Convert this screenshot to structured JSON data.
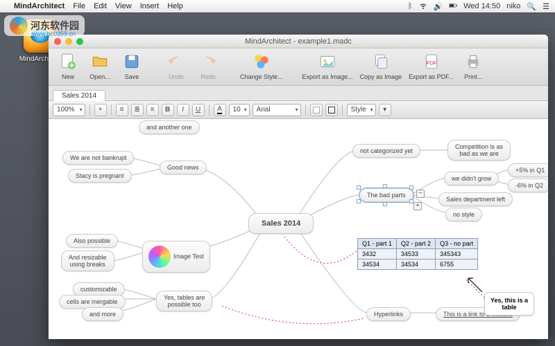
{
  "menubar": {
    "app": "MindArchitect",
    "items": [
      "File",
      "Edit",
      "View",
      "Insert",
      "Help"
    ],
    "clock": "Wed 14:50",
    "user": "niko"
  },
  "desktop": {
    "icon_label": "MindArchitect"
  },
  "watermark": {
    "title": "河东软件园",
    "url": "www.pc0359.cn"
  },
  "window": {
    "title": "MindArchitect - example1.madc",
    "toolbar": [
      {
        "id": "new",
        "label": "New"
      },
      {
        "id": "open",
        "label": "Open..."
      },
      {
        "id": "save",
        "label": "Save"
      },
      {
        "id": "undo",
        "label": "Undo",
        "disabled": true
      },
      {
        "id": "redo",
        "label": "Redo",
        "disabled": true
      },
      {
        "id": "style",
        "label": "Change Style..."
      },
      {
        "id": "expimg",
        "label": "Export as Image..."
      },
      {
        "id": "copyimg",
        "label": "Copy as Image"
      },
      {
        "id": "exppdf",
        "label": "Export as PDF..."
      },
      {
        "id": "print",
        "label": "Print..."
      }
    ],
    "tab": "Sales 2014",
    "format": {
      "zoom": "100%",
      "plus": "+",
      "fontsize": "10",
      "font": "Arial",
      "style_label": "Style"
    }
  },
  "mindmap": {
    "center": "Sales 2014",
    "nodes": {
      "cut_top": "and another one",
      "not_bankrupt": "We are not bankrupt",
      "pregnant": "Stacy is pregnant",
      "good_news": "Good news",
      "also": "Also possible",
      "resizable": "And resizable\nusing breaks",
      "image_test": "Image Test",
      "customizable": "customizable",
      "mergable": "cells are mergable",
      "and_more": "and more",
      "tables": "Yes, tables are\npossible too",
      "not_cat": "not categorized yet",
      "competition": "Competition is as\nbad as we are",
      "bad_parts": "The bad parts",
      "didnt_grow": "we didn't grow",
      "q1up": "+5% in Q1",
      "q2down": "-6% in Q2",
      "sales_left": "Sales department left",
      "no_style": "no style",
      "hyperlinks": "Hyperlinks",
      "link_ex": "This is a link to a website",
      "callout": "Yes, this is a\ntable"
    },
    "table": {
      "headers": [
        "Q1 - part 1",
        "Q2 - part 2",
        "Q3 - no part"
      ],
      "rows": [
        [
          "3432",
          "34533",
          "345343"
        ],
        [
          "34534",
          "34534",
          "6755"
        ]
      ]
    }
  }
}
